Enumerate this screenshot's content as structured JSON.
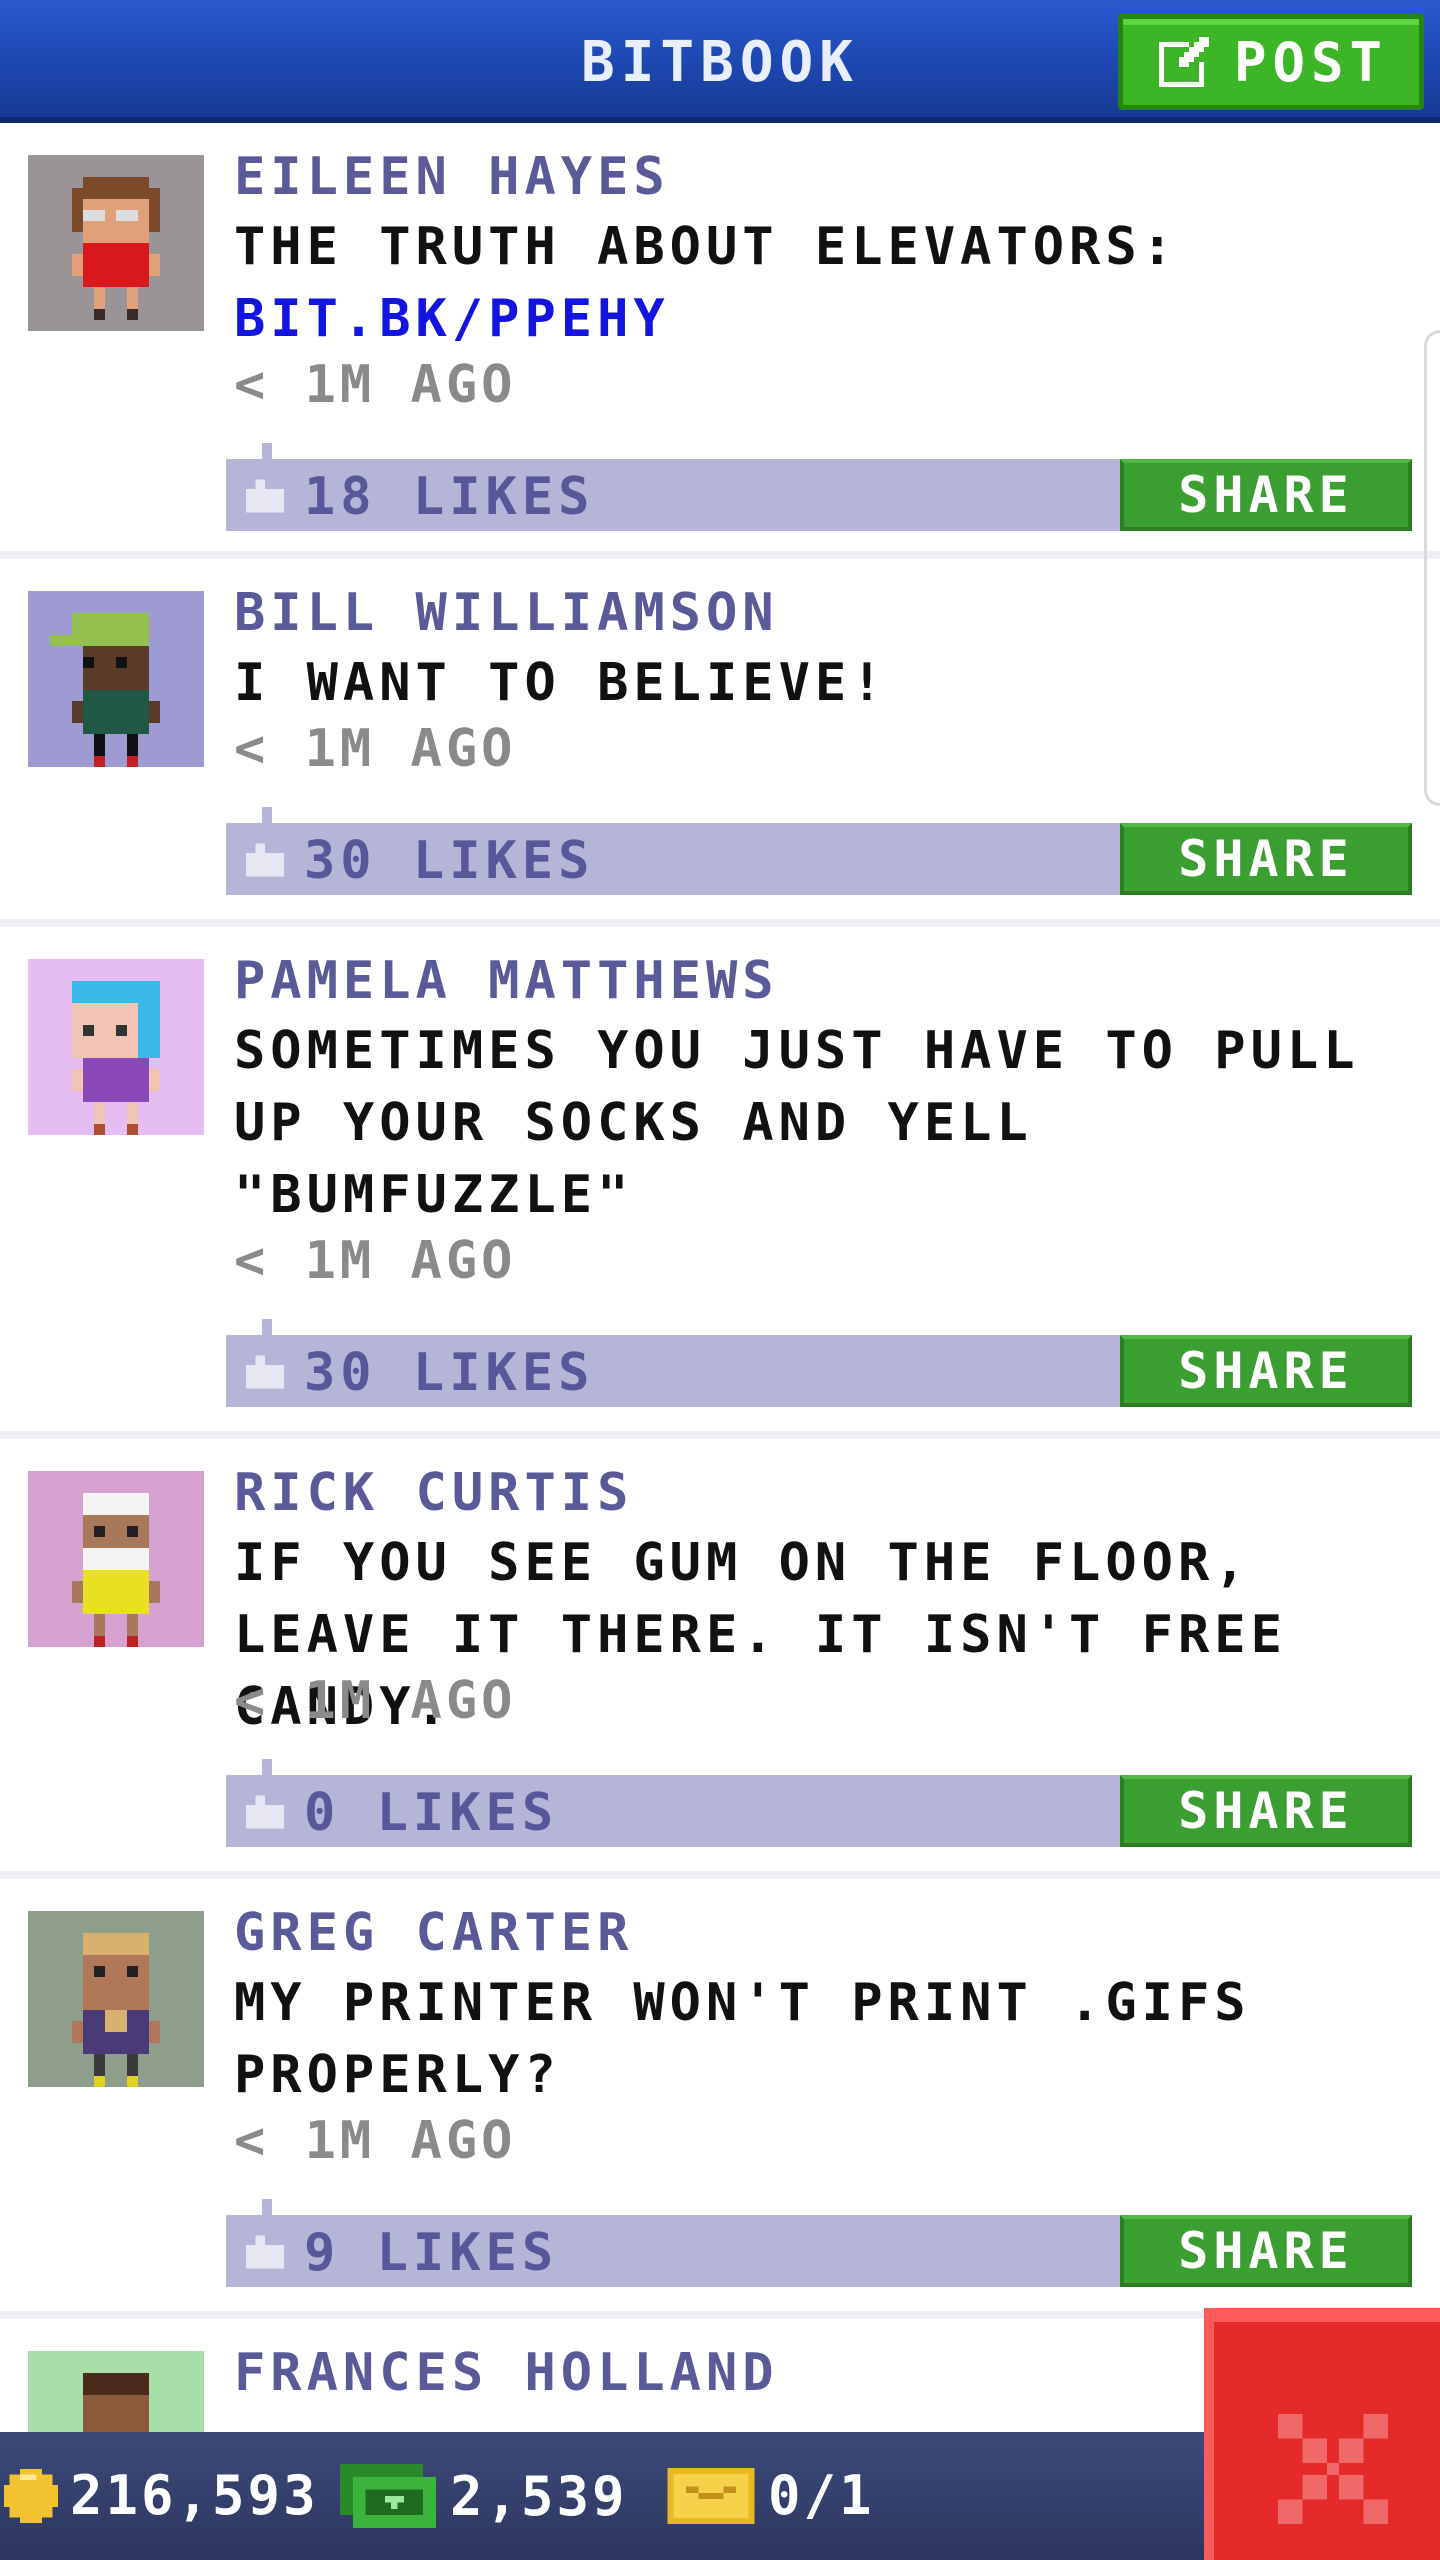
{
  "header": {
    "title": "BITBOOK",
    "post_label": "POST"
  },
  "posts": [
    {
      "author": "EILEEN HAYES",
      "text": "THE TRUTH ABOUT ELEVATORS:",
      "link": "BIT.BK/PPEHY",
      "time": "< 1M AGO",
      "likes": "18 LIKES",
      "share_label": "SHARE",
      "avatar_bg": "#9a9499"
    },
    {
      "author": "BILL WILLIAMSON",
      "text": "I WANT TO BELIEVE!",
      "time": "< 1M AGO",
      "likes": "30 LIKES",
      "share_label": "SHARE",
      "avatar_bg": "#9e9ad2"
    },
    {
      "author": "PAMELA MATTHEWS",
      "text": "SOMETIMES YOU JUST HAVE TO PULL UP YOUR SOCKS AND YELL \"BUMFUZZLE\"",
      "time": "< 1M AGO",
      "likes": "30 LIKES",
      "share_label": "SHARE",
      "avatar_bg": "#e6bdf2"
    },
    {
      "author": "RICK CURTIS",
      "text": "IF YOU SEE GUM ON THE FLOOR, LEAVE IT THERE. IT ISN'T FREE CANDY.",
      "time": "< 1M AGO",
      "likes": "0 LIKES",
      "share_label": "SHARE",
      "avatar_bg": "#d6a2d0"
    },
    {
      "author": "GREG CARTER",
      "text": "MY PRINTER WON'T PRINT .GIFS PROPERLY?",
      "time": "< 1M AGO",
      "likes": "9 LIKES",
      "share_label": "SHARE",
      "avatar_bg": "#8e9e8a"
    },
    {
      "author": "FRANCES HOLLAND",
      "avatar_bg": "#a8dfa8"
    }
  ],
  "status": {
    "coins": "216,593",
    "bux": "2,539",
    "tickets": "0/1"
  },
  "colors": {
    "header": "#1d47b0",
    "accent_green": "#3b9e30",
    "like_bar": "#b5b5d8",
    "author": "#5b5a98",
    "close": "#e52a2a"
  },
  "icons": {
    "post": "edit-icon",
    "like": "thumbs-up-icon",
    "close": "close-icon",
    "coin": "coin-icon",
    "bux": "bux-icon",
    "ticket": "ticket-icon"
  }
}
